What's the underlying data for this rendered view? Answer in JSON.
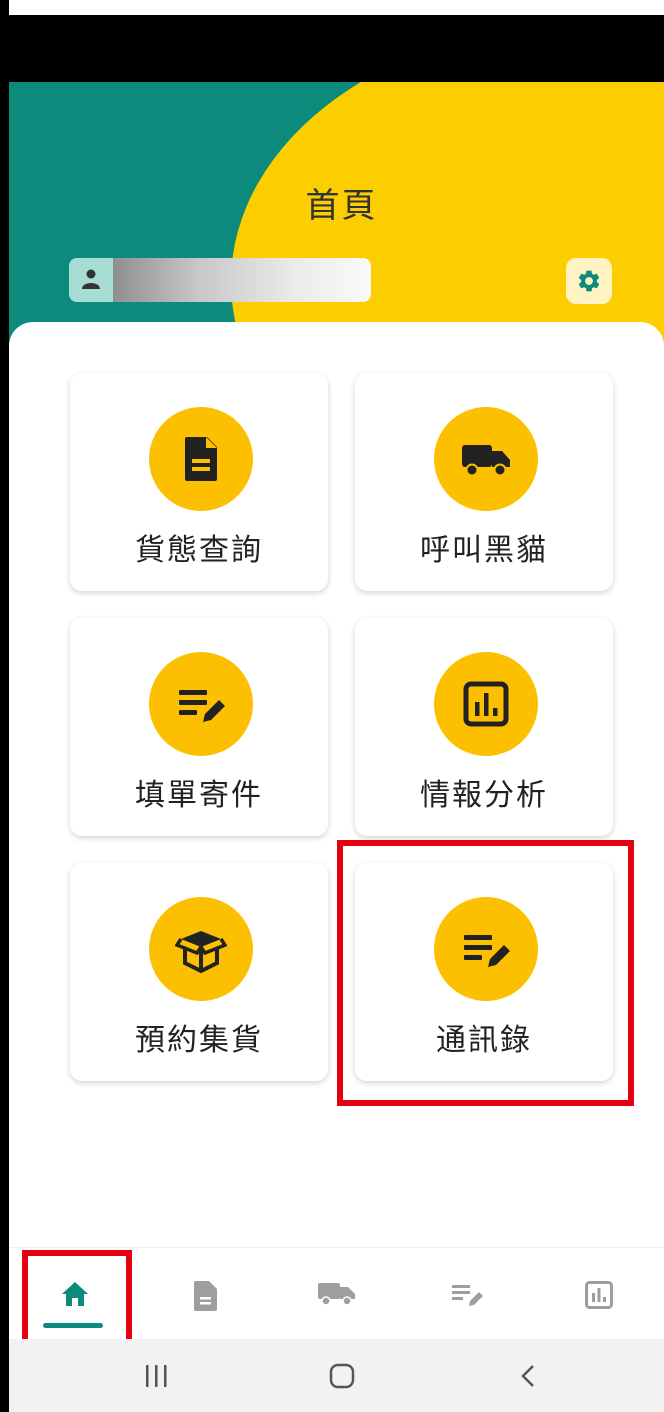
{
  "header": {
    "title": "首頁",
    "account_icon": "user-icon",
    "dropdown_icon": "caret-down-icon",
    "settings_icon": "gear-icon"
  },
  "menu": [
    {
      "label": "貨態查詢",
      "icon": "document-icon"
    },
    {
      "label": "呼叫黑貓",
      "icon": "truck-icon"
    },
    {
      "label": "填單寄件",
      "icon": "edit-list-icon"
    },
    {
      "label": "情報分析",
      "icon": "bar-chart-icon"
    },
    {
      "label": "預約集貨",
      "icon": "box-icon"
    },
    {
      "label": "通訊錄",
      "icon": "edit-list-icon"
    }
  ],
  "bottom_nav": [
    {
      "icon": "home-icon",
      "active": true
    },
    {
      "icon": "document-icon",
      "active": false
    },
    {
      "icon": "truck-icon",
      "active": false
    },
    {
      "icon": "edit-list-icon",
      "active": false
    },
    {
      "icon": "bar-chart-icon",
      "active": false
    }
  ],
  "system_nav": [
    "recent-apps-icon",
    "home-circle-icon",
    "back-icon"
  ],
  "colors": {
    "brand_green": "#0c8a7c",
    "brand_yellow": "#fcce00",
    "icon_circle": "#fcc000",
    "highlight_red": "#e50010",
    "inactive_nav": "#9e9e9e"
  }
}
